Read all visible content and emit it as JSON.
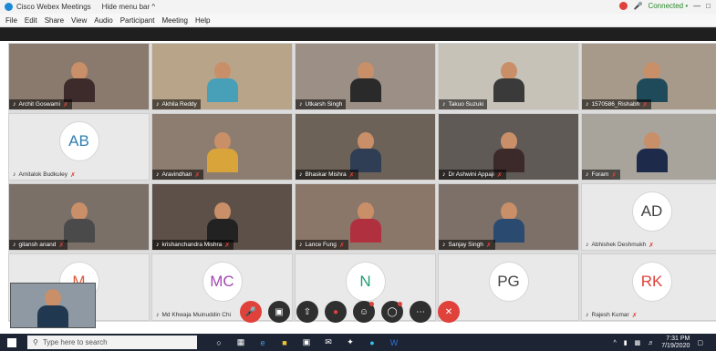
{
  "window": {
    "app_title": "Cisco Webex Meetings",
    "hide_menu": "Hide menu bar ^",
    "status": "Connected •"
  },
  "menu": [
    "File",
    "Edit",
    "Share",
    "View",
    "Audio",
    "Participant",
    "Meeting",
    "Help"
  ],
  "participants": [
    {
      "name": "Archit Goswami",
      "type": "video",
      "muted": true
    },
    {
      "name": "Akhila Reddy",
      "type": "video",
      "muted": false
    },
    {
      "name": "Utkarsh Singh",
      "type": "video",
      "muted": false
    },
    {
      "name": "Takuo Suzuki",
      "type": "video",
      "muted": false
    },
    {
      "name": "1570586_Rishabh",
      "type": "video",
      "muted": true
    },
    {
      "name": "Amitalok Budkuley",
      "type": "avatar",
      "initials": "AB",
      "color": "#2e7fb0",
      "muted": true
    },
    {
      "name": "Aravindhan",
      "type": "video",
      "muted": true
    },
    {
      "name": "Bhaskar Mishra",
      "type": "video",
      "muted": true
    },
    {
      "name": "Dr Ashwini Appaji",
      "type": "video",
      "muted": true
    },
    {
      "name": "Foram",
      "type": "video",
      "muted": true
    },
    {
      "name": "gitansh anand",
      "type": "video",
      "muted": true
    },
    {
      "name": "krishanchandra Mishra",
      "type": "video",
      "muted": true
    },
    {
      "name": "Lance Fung",
      "type": "video",
      "muted": true
    },
    {
      "name": "Sanjay Singh",
      "type": "video",
      "muted": true
    },
    {
      "name": "Abhishek Deshmukh",
      "type": "avatar",
      "initials": "AD",
      "color": "#444444",
      "muted": true
    },
    {
      "name": "",
      "type": "avatar",
      "initials": "M",
      "color": "#e05a3a",
      "muted": false
    },
    {
      "name": "Md Khwaja Muinuddin Chi",
      "type": "avatar",
      "initials": "MC",
      "color": "#a14ab0",
      "muted": false
    },
    {
      "name": "",
      "type": "avatar",
      "initials": "N",
      "color": "#1f9e7a",
      "muted": false
    },
    {
      "name": "",
      "type": "avatar",
      "initials": "PG",
      "color": "#444444",
      "muted": false
    },
    {
      "name": "Rajesh Kumar",
      "type": "avatar",
      "initials": "RK",
      "color": "#e0413a",
      "muted": true
    }
  ],
  "taskbar": {
    "search_placeholder": "Type here to search",
    "time": "7:31 PM",
    "date": "7/19/2020"
  }
}
